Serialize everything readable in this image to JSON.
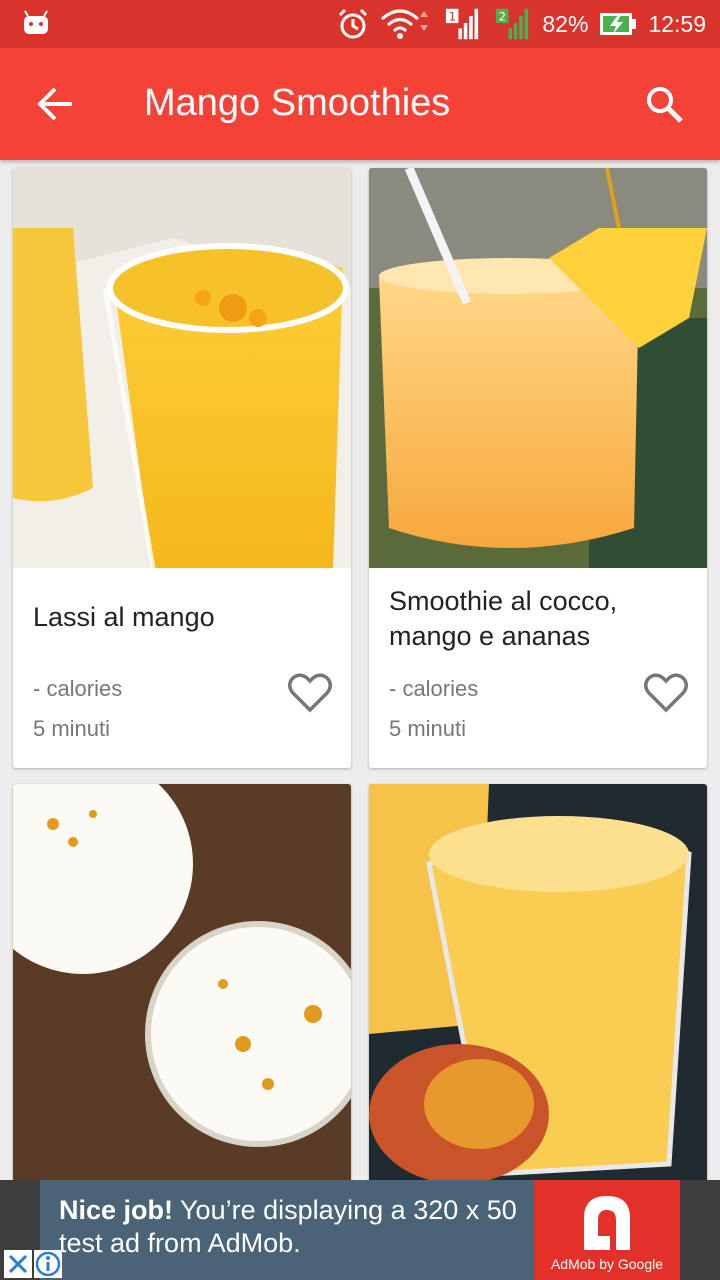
{
  "status_bar": {
    "battery": "82%",
    "time": "12:59",
    "icons": [
      "android-icon",
      "alarm-icon",
      "wifi-icon",
      "signal-sim1-icon",
      "signal-sim2-icon",
      "battery-charging-icon"
    ]
  },
  "app_bar": {
    "title": "Mango Smoothies",
    "back_icon": "arrow-back-icon",
    "search_icon": "search-icon",
    "color": "#f44236"
  },
  "recipes": [
    {
      "name": "Lassi al mango",
      "calories": "- calories",
      "time": "5 minuti",
      "favorite": false
    },
    {
      "name": "Smoothie al cocco, mango e ananas",
      "calories": "- calories",
      "time": "5 minuti",
      "favorite": false
    },
    {
      "name": "",
      "calories": "",
      "time": ""
    },
    {
      "name": "",
      "calories": "",
      "time": ""
    }
  ],
  "ad": {
    "headline": "Nice job!",
    "message": " You’re displaying a 320 x 50 test ad from AdMob.",
    "brand": "AdMob by Google"
  }
}
